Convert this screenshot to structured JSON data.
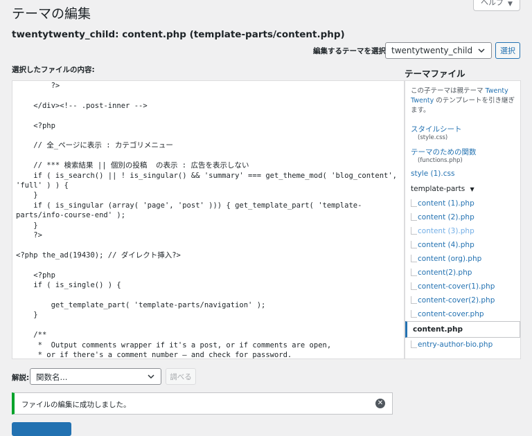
{
  "help_tab": {
    "label": "ヘルプ"
  },
  "page_title": "テーマの編集",
  "file_heading": "twentytwenty_child: content.php (template-parts/content.php)",
  "theme_select": {
    "label": "編集するテーマを選択:",
    "value": "twentytwenty_child",
    "button": "選択"
  },
  "editor": {
    "label": "選択したファイルの内容:",
    "code": "        ?>\n\n    </div><!-- .post-inner -->\n\n    <?php\n\n    // 全_ページに表示 : カテゴリメニュー\n\n    // *** 検索結果 || 個別の投稿  の表示 : 広告を表示しない\n    if ( is_search() || ! is_singular() && 'summary' === get_theme_mod( 'blog_content', 'full' ) ) {\n    }\n    if ( is_singular (array( 'page', 'post' ))) { get_template_part( 'template-parts/info-course-end' );\n    }\n    ?>\n\n<?php the_ad(19430); // ダイレクト挿入?>\n\n    <?php\n    if ( is_single() ) {\n\n        get_template_part( 'template-parts/navigation' );\n    }\n\n    /**\n     *  Output comments wrapper if it's a post, or if comments are open,\n     * or if there's a comment number – and check for password."
  },
  "sidebar": {
    "title": "テーマファイル",
    "description_prefix": "この子テーマは親テーマ",
    "parent_theme": "Twenty Twenty",
    "description_suffix": "のテンプレートを引き継ぎます。",
    "files": [
      {
        "name": "スタイルシート",
        "sub": "(style.css)"
      },
      {
        "name": "テーマのための関数",
        "sub": "(functions.php)"
      },
      {
        "name": "style (1).css",
        "sub": ""
      }
    ],
    "folder": "template-parts",
    "folder_files": [
      {
        "name": "content (1).php",
        "state": "normal"
      },
      {
        "name": "content (2).php",
        "state": "normal"
      },
      {
        "name": "content (3).php",
        "state": "visited"
      },
      {
        "name": "content (4).php",
        "state": "normal"
      },
      {
        "name": "content (org).php",
        "state": "normal"
      },
      {
        "name": "content(2).php",
        "state": "normal"
      },
      {
        "name": "content-cover(1).php",
        "state": "normal"
      },
      {
        "name": "content-cover(2).php",
        "state": "normal"
      },
      {
        "name": "content-cover.php",
        "state": "normal"
      },
      {
        "name": "content.php",
        "state": "active"
      },
      {
        "name": "entry-author-bio.php",
        "state": "normal"
      }
    ]
  },
  "documentation": {
    "label": "解説:",
    "placeholder": "関数名...",
    "button": "調べる"
  },
  "notice": {
    "text": "ファイルの編集に成功しました。"
  }
}
